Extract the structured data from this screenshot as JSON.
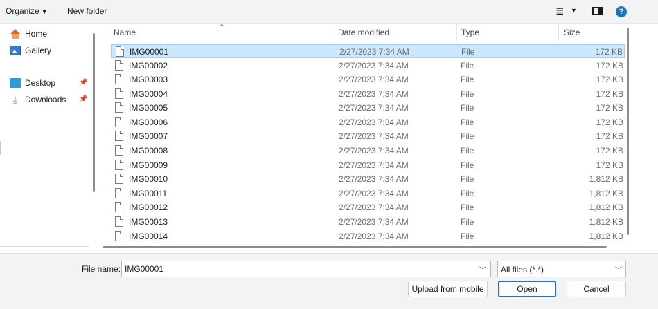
{
  "toolbar": {
    "organize_label": "Organize",
    "new_folder_label": "New folder",
    "help_label": "?"
  },
  "nav": {
    "items": [
      {
        "label": "Home",
        "icon": "home-icon"
      },
      {
        "label": "Gallery",
        "icon": "gallery-icon"
      },
      {
        "label": "Desktop",
        "icon": "desktop-icon",
        "pinned": true
      },
      {
        "label": "Downloads",
        "icon": "downloads-icon",
        "pinned": true
      }
    ]
  },
  "columns": {
    "name": "Name",
    "date": "Date modified",
    "type": "Type",
    "size": "Size"
  },
  "files": [
    {
      "name": "IMG00001",
      "date": "2/27/2023 7:34 AM",
      "type": "File",
      "size": "172 KB",
      "selected": true
    },
    {
      "name": "IMG00002",
      "date": "2/27/2023 7:34 AM",
      "type": "File",
      "size": "172 KB"
    },
    {
      "name": "IMG00003",
      "date": "2/27/2023 7:34 AM",
      "type": "File",
      "size": "172 KB"
    },
    {
      "name": "IMG00004",
      "date": "2/27/2023 7:34 AM",
      "type": "File",
      "size": "172 KB"
    },
    {
      "name": "IMG00005",
      "date": "2/27/2023 7:34 AM",
      "type": "File",
      "size": "172 KB"
    },
    {
      "name": "IMG00006",
      "date": "2/27/2023 7:34 AM",
      "type": "File",
      "size": "172 KB"
    },
    {
      "name": "IMG00007",
      "date": "2/27/2023 7:34 AM",
      "type": "File",
      "size": "172 KB"
    },
    {
      "name": "IMG00008",
      "date": "2/27/2023 7:34 AM",
      "type": "File",
      "size": "172 KB"
    },
    {
      "name": "IMG00009",
      "date": "2/27/2023 7:34 AM",
      "type": "File",
      "size": "172 KB"
    },
    {
      "name": "IMG00010",
      "date": "2/27/2023 7:34 AM",
      "type": "File",
      "size": "1,812 KB"
    },
    {
      "name": "IMG00011",
      "date": "2/27/2023 7:34 AM",
      "type": "File",
      "size": "1,812 KB"
    },
    {
      "name": "IMG00012",
      "date": "2/27/2023 7:34 AM",
      "type": "File",
      "size": "1,812 KB"
    },
    {
      "name": "IMG00013",
      "date": "2/27/2023 7:34 AM",
      "type": "File",
      "size": "1,812 KB"
    },
    {
      "name": "IMG00014",
      "date": "2/27/2023 7:34 AM",
      "type": "File",
      "size": "1,812 KB"
    }
  ],
  "bottom": {
    "file_name_label": "File name:",
    "file_name_value": "IMG00001",
    "file_type_value": "All files (*.*)",
    "upload_label": "Upload from mobile",
    "open_label": "Open",
    "cancel_label": "Cancel"
  },
  "colors": {
    "selection": "#cce8ff",
    "accent": "#2a6fc7"
  }
}
